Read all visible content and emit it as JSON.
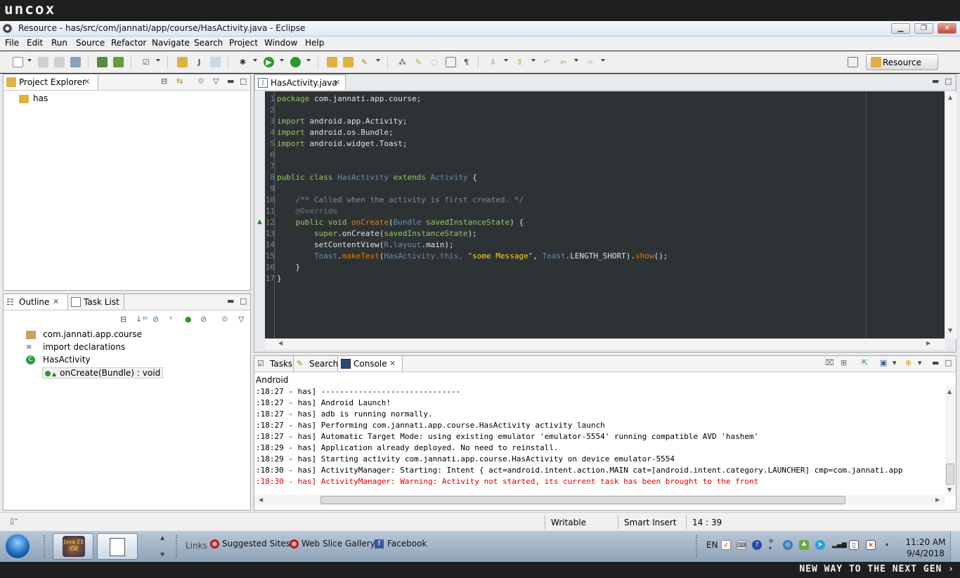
{
  "brand": {
    "logo": "uncox",
    "tagline": "NEW WAY TO THE NEXT GEN ›"
  },
  "window": {
    "title": "Resource - has/src/com/jannati/app/course/HasActivity.java - Eclipse"
  },
  "menu": [
    "File",
    "Edit",
    "Run",
    "Source",
    "Refactor",
    "Navigate",
    "Search",
    "Project",
    "Window",
    "Help"
  ],
  "perspective": {
    "label": "Resource"
  },
  "project_explorer": {
    "title": "Project Explorer",
    "items": [
      "has"
    ]
  },
  "outline": {
    "tabs": [
      "Outline",
      "Task List"
    ],
    "items": [
      "com.jannati.app.course",
      "import declarations",
      "HasActivity",
      "onCreate(Bundle) : void"
    ]
  },
  "editor": {
    "tab": "HasActivity.java",
    "line_numbers": [
      "1",
      "2",
      "3",
      "4",
      "5",
      "6",
      "7",
      "8",
      "9",
      "10",
      "11",
      "12",
      "13",
      "14",
      "15",
      "16",
      "17"
    ],
    "code": {
      "l1": [
        "package",
        "com.jannati.app.course;"
      ],
      "l3": [
        "import",
        "android.app.Activity;"
      ],
      "l4": [
        "import",
        "android.os.Bundle;"
      ],
      "l5": [
        "import",
        "android.widget.Toast;"
      ],
      "l8": [
        "public",
        "class",
        "HasActivity",
        "extends",
        "Activity",
        "{"
      ],
      "l10": "/** Called when the activity is first created. */",
      "l11": "@Override",
      "l12": [
        "public",
        "void",
        "onCreate",
        "(",
        "Bundle",
        "savedInstanceState",
        ") {"
      ],
      "l13": [
        "super",
        ".onCreate(",
        "savedInstanceState",
        ");"
      ],
      "l14": [
        "setContentView(",
        "R",
        ".",
        "layout",
        ".main);"
      ],
      "l15": [
        "Toast",
        ".",
        "makeText",
        "(",
        "HasActivity",
        ".this, ",
        "\"some Message\"",
        ", ",
        "Toast",
        ".LENGTH_SHORT).",
        "show",
        "();"
      ],
      "l16": "}",
      "l17": "}"
    }
  },
  "console_panel": {
    "tabs": [
      "Tasks",
      "Search",
      "Console"
    ],
    "title": "Android",
    "lines": [
      ":18:27 - has] ------------------------------",
      ":18:27 - has] Android Launch!",
      ":18:27 - has] adb is running normally.",
      ":18:27 - has] Performing com.jannati.app.course.HasActivity activity launch",
      ":18:27 - has] Automatic Target Mode: using existing emulator 'emulator-5554' running compatible AVD 'hashem'",
      ":18:29 - has] Application already deployed. No need to reinstall.",
      ":18:29 - has] Starting activity com.jannati.app.course.HasActivity on device emulator-5554",
      ":18:30 - has] ActivityManager: Starting: Intent { act=android.intent.action.MAIN cat=[android.intent.category.LAUNCHER] cmp=com.jannati.app",
      ":18:30 - has] ActivityManager: Warning: Activity not started, its current task has been brought to the front"
    ]
  },
  "status": {
    "writable": "Writable",
    "insert_mode": "Smart Insert",
    "position": "14 : 39"
  },
  "taskbar": {
    "app_label": "Java EE IDE",
    "links_label": "Links",
    "links": [
      "Suggested Sites",
      "Web Slice Gallery",
      "Facebook"
    ],
    "lang": "EN",
    "time": "11:20 AM",
    "date": "9/4/2018"
  },
  "colors": {
    "editor_bg": "#2d3335",
    "keyword": "#93c763",
    "type": "#678cb1",
    "error_text": "#e00000"
  }
}
